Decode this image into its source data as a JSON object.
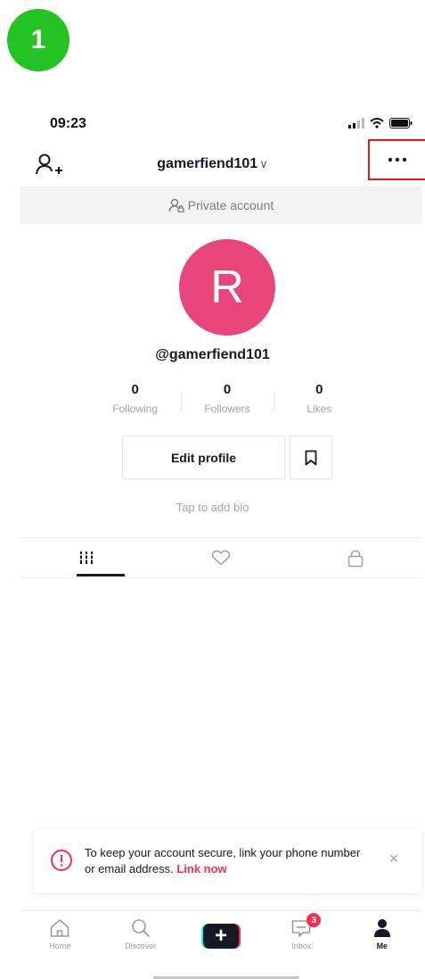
{
  "step_badge": "1",
  "status_bar": {
    "time": "09:23"
  },
  "header": {
    "username": "gamerfiend101",
    "chevron": "∨"
  },
  "privacy": {
    "label": "Private account"
  },
  "profile": {
    "avatar_letter": "R",
    "handle": "@gamerfiend101",
    "stats": [
      {
        "value": "0",
        "label": "Following"
      },
      {
        "value": "0",
        "label": "Followers"
      },
      {
        "value": "0",
        "label": "Likes"
      }
    ],
    "edit_button": "Edit profile",
    "bio_prompt": "Tap to add bio"
  },
  "content_tabs": [
    "videos-grid-icon",
    "liked-heart-icon",
    "private-lock-icon"
  ],
  "toast": {
    "message": "To keep your account secure, link your phone number or email address.",
    "link_text": "Link now",
    "close": "×"
  },
  "tabbar": {
    "items": [
      {
        "label": "Home",
        "icon": "home-icon"
      },
      {
        "label": "Discover",
        "icon": "search-icon"
      },
      {
        "label": "",
        "icon": "create-plus-icon"
      },
      {
        "label": "Inbox",
        "icon": "inbox-icon",
        "badge": "3"
      },
      {
        "label": "Me",
        "icon": "profile-icon"
      }
    ]
  },
  "colors": {
    "avatar": "#e8457a",
    "highlight_box": "#e01b1b",
    "accent": "#fe2c55",
    "cyan": "#25f4ee",
    "step_badge": "#22c322"
  }
}
